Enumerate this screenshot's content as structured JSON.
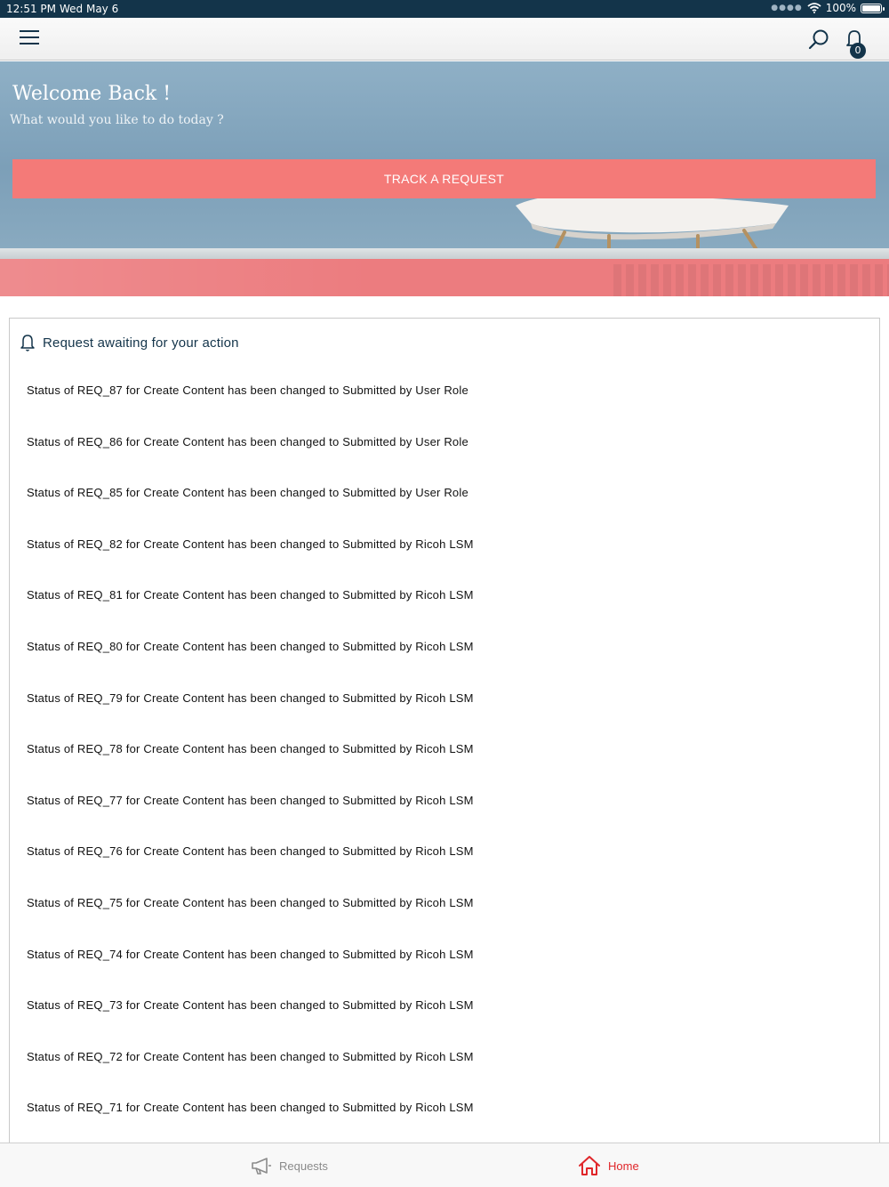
{
  "status_bar": {
    "time": "12:51 PM",
    "date": "Wed May 6",
    "battery": "100%",
    "battery_fraction": 1.0
  },
  "top_nav": {
    "notification_count": "0"
  },
  "hero": {
    "title": "Welcome Back !",
    "subtitle": "What would you like to do today ?",
    "track_button": "TRACK A REQUEST"
  },
  "awaiting": {
    "title": "Request awaiting for your action",
    "items": [
      "Status of REQ_87 for Create Content has been changed to Submitted by User Role",
      "Status of REQ_86 for Create Content has been changed to Submitted by User Role",
      "Status of REQ_85 for Create Content has been changed to Submitted by User Role",
      "Status of REQ_82 for Create Content has been changed to Submitted by Ricoh LSM",
      "Status of REQ_81 for Create Content has been changed to Submitted by Ricoh LSM",
      "Status of REQ_80 for Create Content has been changed to Submitted by Ricoh LSM",
      "Status of REQ_79 for Create Content has been changed to Submitted by Ricoh LSM",
      "Status of REQ_78 for Create Content has been changed to Submitted by Ricoh LSM",
      "Status of REQ_77 for Create Content has been changed to Submitted by Ricoh LSM",
      "Status of REQ_76 for Create Content has been changed to Submitted by Ricoh LSM",
      "Status of REQ_75 for Create Content has been changed to Submitted by Ricoh LSM",
      "Status of REQ_74 for Create Content has been changed to Submitted by Ricoh LSM",
      "Status of REQ_73 for Create Content has been changed to Submitted by Ricoh LSM",
      "Status of REQ_72 for Create Content has been changed to Submitted by Ricoh LSM",
      "Status of REQ_71 for Create Content has been changed to Submitted by Ricoh LSM"
    ]
  },
  "tab_bar": {
    "requests_label": "Requests",
    "home_label": "Home",
    "active_color": "#e0262a",
    "inactive_color": "#8a8a8a"
  },
  "colors": {
    "navy": "#13344a",
    "accent": "#f47a78"
  }
}
